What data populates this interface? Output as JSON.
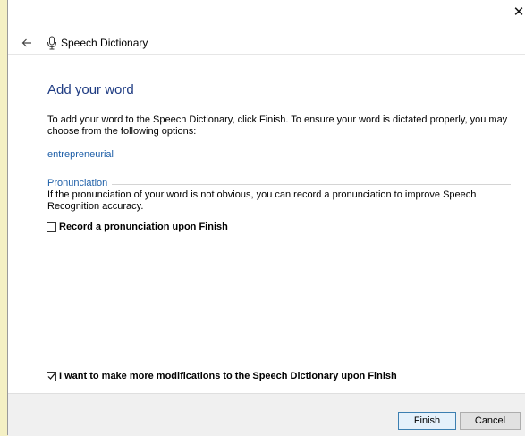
{
  "titlebar": {
    "close_glyph": "✕"
  },
  "nav": {
    "back_icon": "back-arrow-icon",
    "app_icon": "microphone-icon",
    "title": "Speech Dictionary"
  },
  "main": {
    "heading": "Add your word",
    "instructions": "To add your word to the Speech Dictionary, click Finish.  To ensure your word is dictated properly, you may choose from the following options:",
    "word": "entrepreneurial",
    "pronunciation": {
      "section_label": "Pronunciation",
      "description": "If the pronunciation of your word is not obvious, you can record a pronunciation to improve Speech Recognition accuracy.",
      "record_checkbox": {
        "label": "Record a pronunciation upon Finish",
        "checked": false
      }
    },
    "more_modifications_checkbox": {
      "label": "I want to make more modifications to the Speech Dictionary upon Finish",
      "checked": true
    }
  },
  "footer": {
    "finish_label": "Finish",
    "cancel_label": "Cancel"
  },
  "colors": {
    "heading": "#1e3b82",
    "accent_link": "#1e5fa8",
    "desktop_background": "#f4f0c4"
  }
}
